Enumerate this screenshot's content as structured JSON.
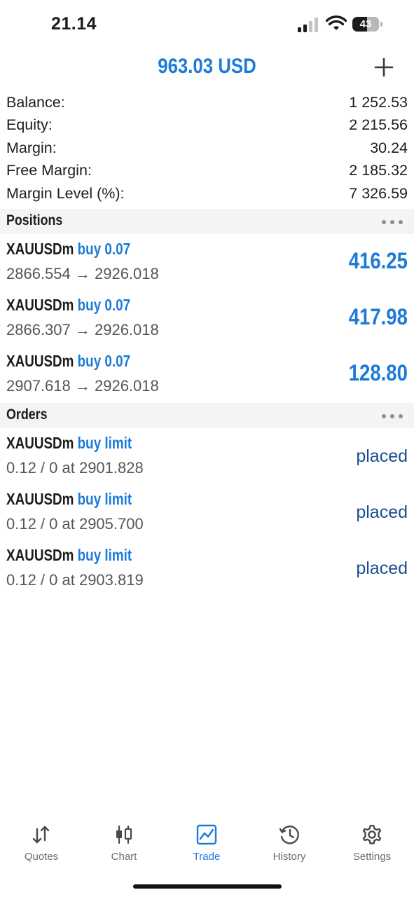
{
  "status_bar": {
    "time": "21.14",
    "battery": "43"
  },
  "header": {
    "title": "963.03 USD",
    "add_icon": "plus-icon"
  },
  "summary": [
    {
      "label": "Balance:",
      "value": "1 252.53"
    },
    {
      "label": "Equity:",
      "value": "2 215.56"
    },
    {
      "label": "Margin:",
      "value": "30.24"
    },
    {
      "label": "Free Margin:",
      "value": "2 185.32"
    },
    {
      "label": "Margin Level (%):",
      "value": "7 326.59"
    }
  ],
  "positions": {
    "title": "Positions",
    "items": [
      {
        "symbol": "XAUUSDm",
        "type": "buy 0.07",
        "prices": "2866.554 → 2926.018",
        "profit": "416.25"
      },
      {
        "symbol": "XAUUSDm",
        "type": "buy 0.07",
        "prices": "2866.307 → 2926.018",
        "profit": "417.98"
      },
      {
        "symbol": "XAUUSDm",
        "type": "buy 0.07",
        "prices": "2907.618 → 2926.018",
        "profit": "128.80"
      }
    ]
  },
  "orders": {
    "title": "Orders",
    "items": [
      {
        "symbol": "XAUUSDm",
        "type": "buy limit",
        "details": "0.12 / 0 at 2901.828",
        "status": "placed"
      },
      {
        "symbol": "XAUUSDm",
        "type": "buy limit",
        "details": "0.12 / 0 at 2905.700",
        "status": "placed"
      },
      {
        "symbol": "XAUUSDm",
        "type": "buy limit",
        "details": "0.12 / 0 at 2903.819",
        "status": "placed"
      }
    ]
  },
  "tabs": [
    {
      "label": "Quotes",
      "icon": "quotes-arrows-icon",
      "active": false
    },
    {
      "label": "Chart",
      "icon": "candlestick-chart-icon",
      "active": false
    },
    {
      "label": "Trade",
      "icon": "trade-chart-icon",
      "active": true
    },
    {
      "label": "History",
      "icon": "history-clock-icon",
      "active": false
    },
    {
      "label": "Settings",
      "icon": "gear-icon",
      "active": false
    }
  ],
  "colors": {
    "accent": "#1d7ad9",
    "status_placed": "#1a4f8f",
    "section_bg": "#f4f4f6"
  }
}
